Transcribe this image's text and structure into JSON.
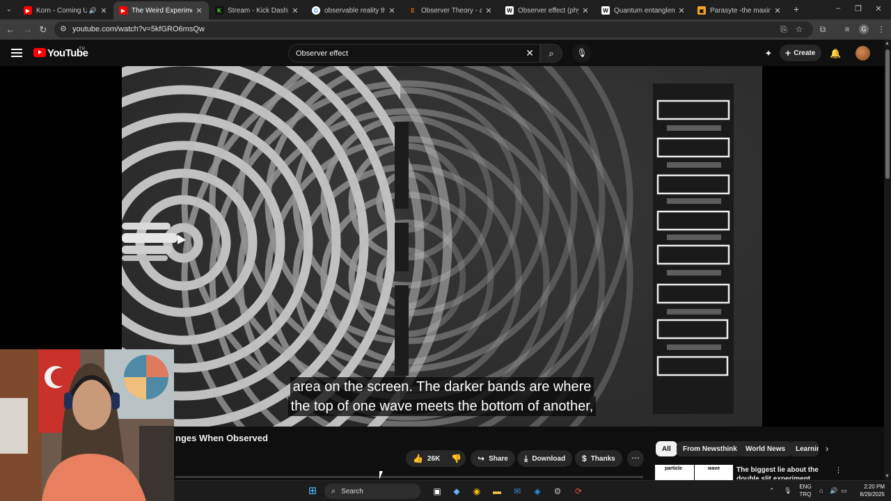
{
  "browser": {
    "tabs": [
      {
        "title": "Korn - Coming Undone",
        "fav_color": "#ff0000",
        "fav_char": "▶",
        "audio": true
      },
      {
        "title": "The Weird Experiment that",
        "fav_color": "#ff0000",
        "fav_char": "▶",
        "active": true
      },
      {
        "title": "Stream - Kick Dashboard",
        "fav_color": "#53fc18",
        "fav_char": "K"
      },
      {
        "title": "observable reality theory",
        "fav_color": "#4285f4",
        "fav_char": "G"
      },
      {
        "title": "Observer Theory - an ove",
        "fav_color": "#e8710a",
        "fav_char": "E"
      },
      {
        "title": "Observer effect (physics)",
        "fav_color": "#ffffff",
        "fav_char": "W"
      },
      {
        "title": "Quantum entanglement",
        "fav_color": "#ffffff",
        "fav_char": "W"
      },
      {
        "title": "Parasyte -the maxim- Epi",
        "fav_color": "#f5a623",
        "fav_char": "▣"
      }
    ],
    "url": "youtube.com/watch?v=5kfGRO6msQw",
    "profile_initial": "G"
  },
  "youtube": {
    "logo_text": "YouTube",
    "region": "TR",
    "search_query": "Observer effect",
    "create_label": "Create"
  },
  "video": {
    "caption_lines": [
      "area on the screen. The darker bands are where",
      "the top of one wave meets the bottom of another,"
    ],
    "title_visible": "nges When Observed",
    "like_count": "26K",
    "share_label": "Share",
    "download_label": "Download",
    "thanks_label": "Thanks"
  },
  "sidebar": {
    "chips": [
      "All",
      "From Newsthink",
      "World News",
      "Learnin"
    ],
    "rec": {
      "thumb_left": "particle",
      "thumb_right": "wave",
      "title": "The biggest lie about the double slit experiment"
    }
  },
  "taskbar": {
    "search_label": "Search",
    "lang_line1": "ENG",
    "lang_line2": "TRQ",
    "time": "2:20 PM",
    "date": "8/29/2025"
  },
  "colors": {
    "yt_red": "#ff0000",
    "bg": "#0f0f0f",
    "chip_bg": "#272727"
  }
}
